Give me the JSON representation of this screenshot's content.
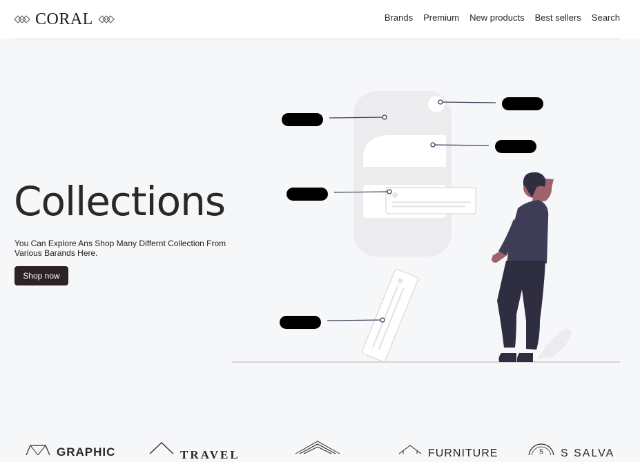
{
  "header": {
    "logo_text": "CORAL",
    "nav": [
      "Brands",
      "Premium",
      "New products",
      "Best sellers",
      "Search"
    ]
  },
  "hero": {
    "title": "Collections",
    "description": "You Can Explore Ans Shop Many Differnt Collection From Various Barands Here.",
    "cta": "Shop now"
  },
  "illustration": {
    "name": "person-viewing-ui-cards-illustration",
    "accent_dark": "#3f3d56",
    "accent_skin": "#a0616a"
  },
  "brands": [
    {
      "name": "GRAPHIC",
      "icon": "diamond-icon"
    },
    {
      "name": "TRAVEL",
      "icon": "house-icon"
    },
    {
      "name": "",
      "icon": "layers-icon"
    },
    {
      "name": "FURNITURE",
      "icon": "house-outline-icon"
    },
    {
      "name": "S SALVA",
      "icon": "s-circle-icon"
    }
  ],
  "colors": {
    "page_bg": "#f6f7f9",
    "header_bg": "#ffffff",
    "button_bg": "#2d2224",
    "text": "#2a2526"
  }
}
